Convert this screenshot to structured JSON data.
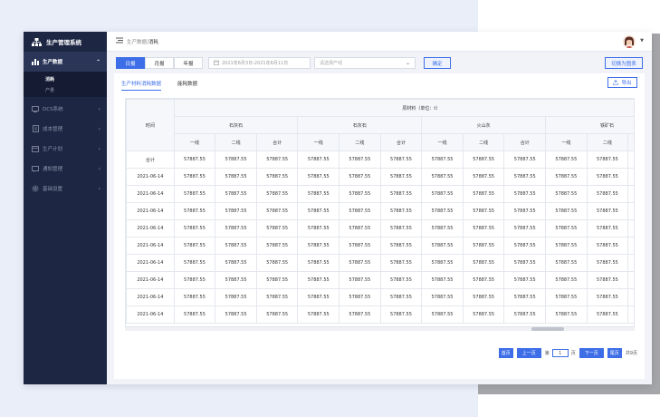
{
  "app": {
    "title": "生产管理系统"
  },
  "sidebar": {
    "items": [
      {
        "label": "生产数据",
        "icon": "bar-chart-icon",
        "active": true
      },
      {
        "label": "DCS系统",
        "icon": "monitor-icon",
        "active": false
      },
      {
        "label": "成本管理",
        "icon": "document-icon",
        "active": false
      },
      {
        "label": "生产计划",
        "icon": "calendar-icon",
        "active": false
      },
      {
        "label": "通知管理",
        "icon": "message-icon",
        "active": false
      },
      {
        "label": "基础设置",
        "icon": "gear-icon",
        "active": false
      }
    ],
    "submenu": [
      {
        "label": "消耗",
        "active": true
      },
      {
        "label": "产量",
        "active": false
      }
    ]
  },
  "header": {
    "breadcrumb_parent": "生产数据/",
    "breadcrumb_current": "消耗"
  },
  "filters": {
    "periods": [
      "日报",
      "月报",
      "年报"
    ],
    "active_period": "日报",
    "date_range": "2021年6月3日-2021年6月11日",
    "line_placeholder": "请选择产线",
    "confirm_label": "确定",
    "switch_chart_label": "切换为图表"
  },
  "tabs": [
    {
      "label": "生产材料消耗数据",
      "active": true
    },
    {
      "label": "能耗数据",
      "active": false
    }
  ],
  "export_label": "导出",
  "table": {
    "time_header": "时间",
    "group_header": "原材料（单位：t）",
    "materials": [
      {
        "name": "石灰石",
        "cols": [
          "一线",
          "二线",
          "合计"
        ]
      },
      {
        "name": "石灰石",
        "cols": [
          "一线",
          "二线",
          "合计"
        ]
      },
      {
        "name": "火山灰",
        "cols": [
          "一线",
          "二线",
          "合计"
        ]
      },
      {
        "name": "铁矿石",
        "cols": [
          "一线",
          "二线"
        ]
      }
    ],
    "rows": [
      {
        "time": "合计",
        "values": [
          "57887.55",
          "57887.55",
          "57887.55",
          "57887.55",
          "57887.55",
          "57887.55",
          "57887.55",
          "57887.55",
          "57887.55",
          "57887.55",
          "57887.55"
        ]
      },
      {
        "time": "2021-06-14",
        "values": [
          "57887.55",
          "57887.55",
          "57887.55",
          "57887.55",
          "57887.55",
          "57887.55",
          "57887.55",
          "57887.55",
          "57887.55",
          "57887.55",
          "57887.55"
        ]
      },
      {
        "time": "2021-06-14",
        "values": [
          "57887.55",
          "57887.55",
          "57887.55",
          "57887.55",
          "57887.55",
          "57887.55",
          "57887.55",
          "57887.55",
          "57887.55",
          "57887.55",
          "57887.55"
        ]
      },
      {
        "time": "2021-06-14",
        "values": [
          "57887.55",
          "57887.55",
          "57887.55",
          "57887.55",
          "57887.55",
          "57887.55",
          "57887.55",
          "57887.55",
          "57887.55",
          "57887.55",
          "57887.55"
        ]
      },
      {
        "time": "2021-06-14",
        "values": [
          "57887.55",
          "57887.55",
          "57887.55",
          "57887.55",
          "57887.55",
          "57887.55",
          "57887.55",
          "57887.55",
          "57887.55",
          "57887.55",
          "57887.55"
        ]
      },
      {
        "time": "2021-06-14",
        "values": [
          "57887.55",
          "57887.55",
          "57887.55",
          "57887.55",
          "57887.55",
          "57887.55",
          "57887.55",
          "57887.55",
          "57887.55",
          "57887.55",
          "57887.55"
        ]
      },
      {
        "time": "2021-06-14",
        "values": [
          "57887.55",
          "57887.55",
          "57887.55",
          "57887.55",
          "57887.55",
          "57887.55",
          "57887.55",
          "57887.55",
          "57887.55",
          "57887.55",
          "57887.55"
        ]
      },
      {
        "time": "2021-06-14",
        "values": [
          "57887.55",
          "57887.55",
          "57887.55",
          "57887.55",
          "57887.55",
          "57887.55",
          "57887.55",
          "57887.55",
          "57887.55",
          "57887.55",
          "57887.55"
        ]
      },
      {
        "time": "2021-06-14",
        "values": [
          "57887.55",
          "57887.55",
          "57887.55",
          "57887.55",
          "57887.55",
          "57887.55",
          "57887.55",
          "57887.55",
          "57887.55",
          "57887.55",
          "57887.55"
        ]
      },
      {
        "time": "2021-06-14",
        "values": [
          "57887.55",
          "57887.55",
          "57887.55",
          "57887.55",
          "57887.55",
          "57887.55",
          "57887.55",
          "57887.55",
          "57887.55",
          "57887.55",
          "57887.55"
        ]
      }
    ]
  },
  "pagination": {
    "first": "首页",
    "prev": "上一页",
    "page_prefix": "第",
    "page": "1",
    "page_suffix": "页",
    "next": "下一页",
    "last": "尾页",
    "total": "共9页"
  },
  "colors": {
    "primary": "#3d6ee8",
    "sidebar": "#1d2643"
  }
}
